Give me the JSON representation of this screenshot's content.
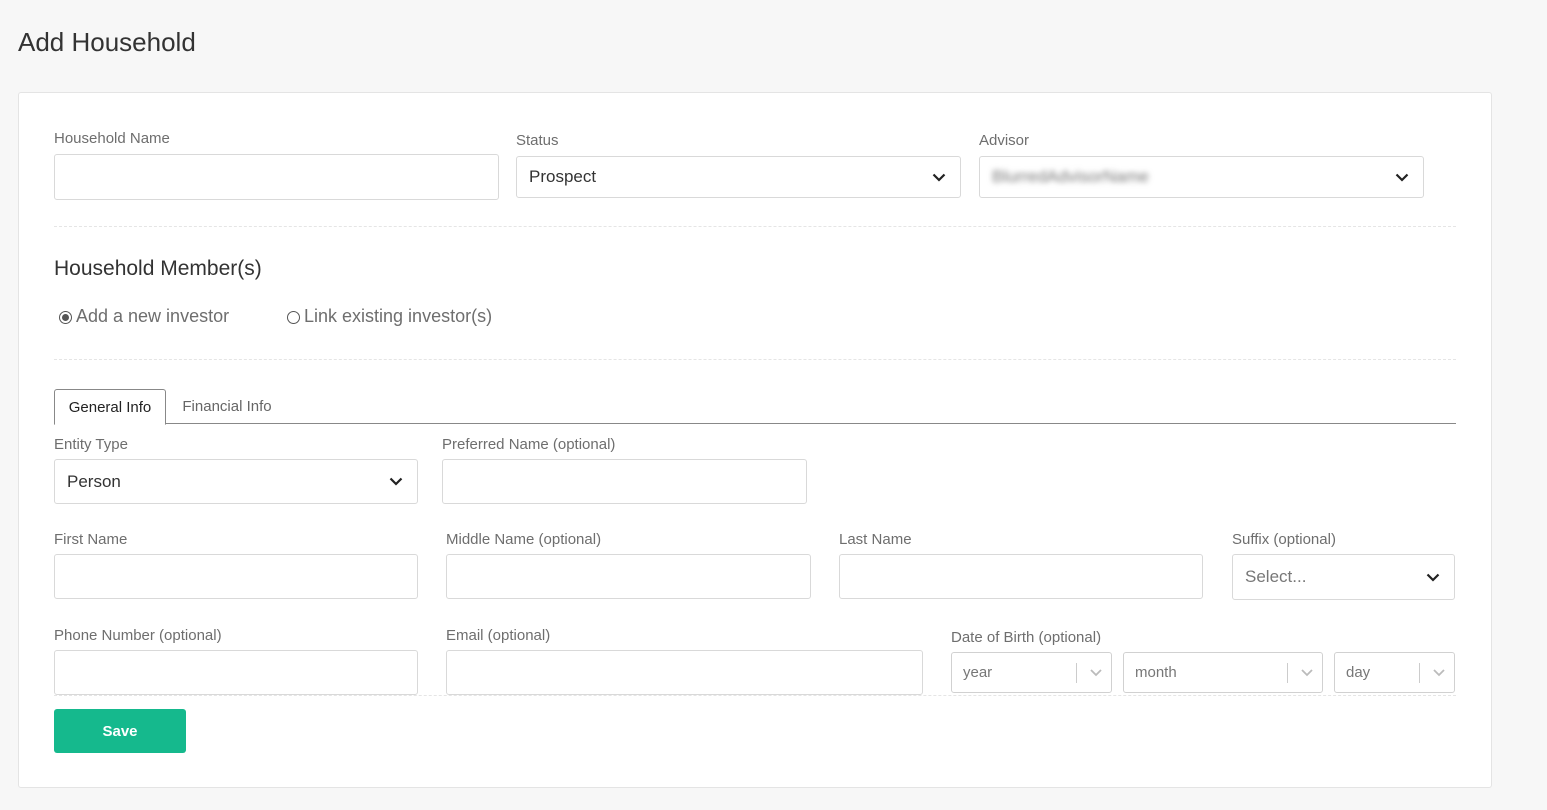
{
  "page": {
    "title": "Add Household"
  },
  "household": {
    "name_label": "Household Name",
    "name_value": "",
    "status_label": "Status",
    "status_value": "Prospect",
    "advisor_label": "Advisor",
    "advisor_value": "BlurredAdvisorName"
  },
  "members": {
    "title": "Household Member(s)",
    "radio_new": "Add a new investor",
    "radio_existing": "Link existing investor(s)",
    "selected": "new"
  },
  "tabs": [
    {
      "label": "General Info",
      "active": true
    },
    {
      "label": "Financial Info",
      "active": false
    }
  ],
  "form": {
    "entity_type_label": "Entity Type",
    "entity_type_value": "Person",
    "preferred_name_label": "Preferred Name (optional)",
    "first_name_label": "First Name",
    "middle_name_label": "Middle Name (optional)",
    "last_name_label": "Last Name",
    "suffix_label": "Suffix (optional)",
    "suffix_placeholder": "Select...",
    "phone_label": "Phone Number (optional)",
    "email_label": "Email (optional)",
    "dob_label": "Date of Birth (optional)",
    "dob_year": "year",
    "dob_month": "month",
    "dob_day": "day"
  },
  "actions": {
    "save_label": "Save"
  },
  "colors": {
    "accent": "#15b98d",
    "background": "#f7f7f7",
    "card": "#ffffff"
  }
}
